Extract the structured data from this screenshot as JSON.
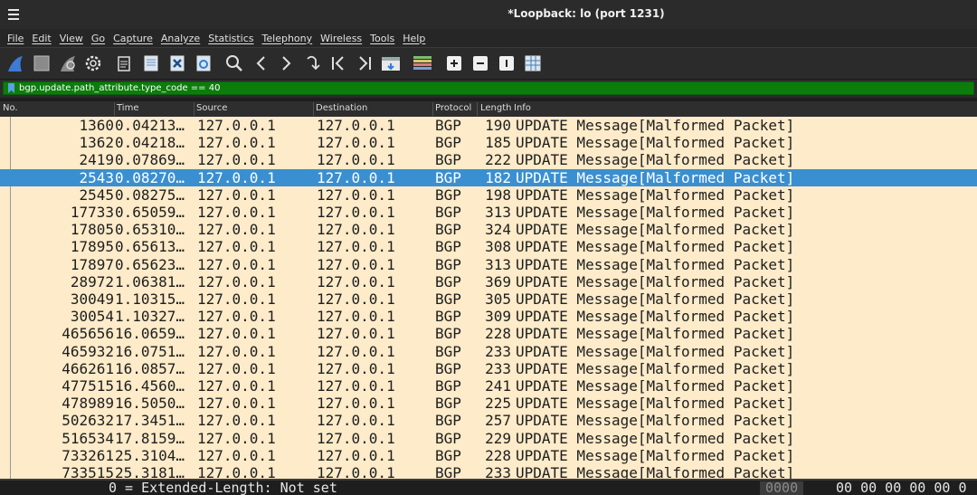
{
  "window": {
    "title": "*Loopback: lo (port 1231)"
  },
  "menu": [
    "File",
    "Edit",
    "View",
    "Go",
    "Capture",
    "Analyze",
    "Statistics",
    "Telephony",
    "Wireless",
    "Tools",
    "Help"
  ],
  "toolbar": {
    "icons": [
      "shark-fin-start-icon",
      "stop-square-icon",
      "restart-fin-icon",
      "options-gear-icon",
      "open-file-icon",
      "save-file-icon",
      "close-file-icon",
      "reload-file-icon",
      "find-packet-icon",
      "go-back-icon",
      "go-forward-icon",
      "go-to-packet-icon",
      "first-packet-icon",
      "last-packet-icon",
      "autoscroll-icon",
      "colorize-icon",
      "zoom-in-icon",
      "zoom-out-icon",
      "normal-size-icon",
      "resize-columns-icon"
    ]
  },
  "filter": {
    "value": "bgp.update.path_attribute.type_code == 40"
  },
  "columns": [
    "No.",
    "Time",
    "Source",
    "Destination",
    "Protocol",
    "Length",
    "Info"
  ],
  "packets": [
    {
      "no": "1360",
      "time": "0.04213…",
      "src": "127.0.0.1",
      "dst": "127.0.0.1",
      "proto": "BGP",
      "len": "190",
      "info": "UPDATE Message[Malformed Packet]"
    },
    {
      "no": "1362",
      "time": "0.04218…",
      "src": "127.0.0.1",
      "dst": "127.0.0.1",
      "proto": "BGP",
      "len": "185",
      "info": "UPDATE Message[Malformed Packet]"
    },
    {
      "no": "2419",
      "time": "0.07869…",
      "src": "127.0.0.1",
      "dst": "127.0.0.1",
      "proto": "BGP",
      "len": "222",
      "info": "UPDATE Message[Malformed Packet]"
    },
    {
      "no": "2543",
      "time": "0.08270…",
      "src": "127.0.0.1",
      "dst": "127.0.0.1",
      "proto": "BGP",
      "len": "182",
      "info": "UPDATE Message[Malformed Packet]",
      "selected": true
    },
    {
      "no": "2545",
      "time": "0.08275…",
      "src": "127.0.0.1",
      "dst": "127.0.0.1",
      "proto": "BGP",
      "len": "198",
      "info": "UPDATE Message[Malformed Packet]"
    },
    {
      "no": "17733",
      "time": "0.65059…",
      "src": "127.0.0.1",
      "dst": "127.0.0.1",
      "proto": "BGP",
      "len": "313",
      "info": "UPDATE Message[Malformed Packet]"
    },
    {
      "no": "17805",
      "time": "0.65310…",
      "src": "127.0.0.1",
      "dst": "127.0.0.1",
      "proto": "BGP",
      "len": "324",
      "info": "UPDATE Message[Malformed Packet]"
    },
    {
      "no": "17895",
      "time": "0.65613…",
      "src": "127.0.0.1",
      "dst": "127.0.0.1",
      "proto": "BGP",
      "len": "308",
      "info": "UPDATE Message[Malformed Packet]"
    },
    {
      "no": "17897",
      "time": "0.65623…",
      "src": "127.0.0.1",
      "dst": "127.0.0.1",
      "proto": "BGP",
      "len": "313",
      "info": "UPDATE Message[Malformed Packet]"
    },
    {
      "no": "28972",
      "time": "1.06381…",
      "src": "127.0.0.1",
      "dst": "127.0.0.1",
      "proto": "BGP",
      "len": "369",
      "info": "UPDATE Message[Malformed Packet]"
    },
    {
      "no": "30049",
      "time": "1.10315…",
      "src": "127.0.0.1",
      "dst": "127.0.0.1",
      "proto": "BGP",
      "len": "305",
      "info": "UPDATE Message[Malformed Packet]"
    },
    {
      "no": "30054",
      "time": "1.10327…",
      "src": "127.0.0.1",
      "dst": "127.0.0.1",
      "proto": "BGP",
      "len": "309",
      "info": "UPDATE Message[Malformed Packet]"
    },
    {
      "no": "465656",
      "time": "16.0659…",
      "src": "127.0.0.1",
      "dst": "127.0.0.1",
      "proto": "BGP",
      "len": "228",
      "info": "UPDATE Message[Malformed Packet]"
    },
    {
      "no": "465932",
      "time": "16.0751…",
      "src": "127.0.0.1",
      "dst": "127.0.0.1",
      "proto": "BGP",
      "len": "233",
      "info": "UPDATE Message[Malformed Packet]"
    },
    {
      "no": "466261",
      "time": "16.0857…",
      "src": "127.0.0.1",
      "dst": "127.0.0.1",
      "proto": "BGP",
      "len": "233",
      "info": "UPDATE Message[Malformed Packet]"
    },
    {
      "no": "477515",
      "time": "16.4560…",
      "src": "127.0.0.1",
      "dst": "127.0.0.1",
      "proto": "BGP",
      "len": "241",
      "info": "UPDATE Message[Malformed Packet]"
    },
    {
      "no": "478989",
      "time": "16.5050…",
      "src": "127.0.0.1",
      "dst": "127.0.0.1",
      "proto": "BGP",
      "len": "225",
      "info": "UPDATE Message[Malformed Packet]"
    },
    {
      "no": "502632",
      "time": "17.3451…",
      "src": "127.0.0.1",
      "dst": "127.0.0.1",
      "proto": "BGP",
      "len": "257",
      "info": "UPDATE Message[Malformed Packet]"
    },
    {
      "no": "516534",
      "time": "17.8159…",
      "src": "127.0.0.1",
      "dst": "127.0.0.1",
      "proto": "BGP",
      "len": "229",
      "info": "UPDATE Message[Malformed Packet]"
    },
    {
      "no": "733261",
      "time": "25.3104…",
      "src": "127.0.0.1",
      "dst": "127.0.0.1",
      "proto": "BGP",
      "len": "228",
      "info": "UPDATE Message[Malformed Packet]"
    },
    {
      "no": "733515",
      "time": "25.3181…",
      "src": "127.0.0.1",
      "dst": "127.0.0.1",
      "proto": "BGP",
      "len": "233",
      "info": "UPDATE Message[Malformed Packet]"
    }
  ],
  "details": {
    "line": "0      = Extended-Length: Not set"
  },
  "bytes": {
    "offset": "0000",
    "hex": "00 00 00 00 00 0"
  },
  "colors": {
    "list_bg": "#fdebc9",
    "selected_bg": "#3a8fd0",
    "filter_bg": "#0b7d0b"
  }
}
